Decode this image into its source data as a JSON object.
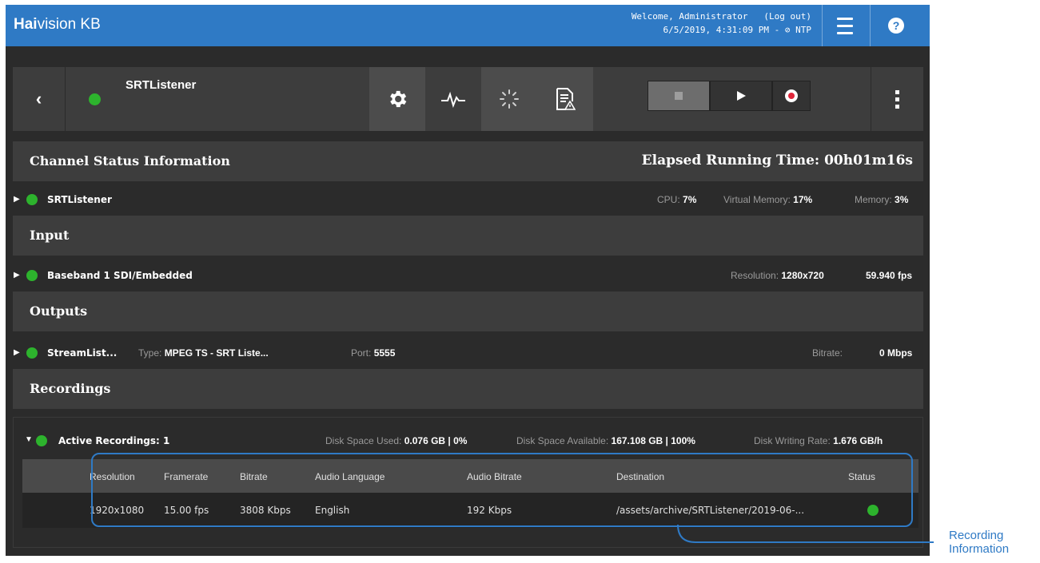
{
  "header": {
    "brand_bold": "Hai",
    "brand_rest": "vision KB",
    "welcome_line": "Welcome, Administrator",
    "logout": "(Log out)",
    "datetime": "6/5/2019, 4:31:09 PM - ",
    "ntp": "⊘ NTP",
    "menu_icon": "hamburger-icon",
    "help_icon": "help-icon",
    "help_glyph": "?"
  },
  "toolbar": {
    "back_glyph": "‹",
    "channel_name": "SRTListener",
    "icons": [
      "gear-icon",
      "signal-icon",
      "loading-icon",
      "report-warning-icon"
    ],
    "transport": [
      "stop",
      "play",
      "record"
    ]
  },
  "status": {
    "title": "Channel Status Information",
    "elapsed": "Elapsed Running Time: 00h01m16s",
    "channel_row": {
      "name": "SRTListener",
      "cpu_label": "CPU: ",
      "cpu_value": "7%",
      "vmem_label": "Virtual Memory: ",
      "vmem_value": "17%",
      "mem_label": "Memory: ",
      "mem_value": "3%"
    }
  },
  "input": {
    "title": "Input",
    "row": {
      "name": "Baseband 1 SDI/Embedded",
      "res_label": "Resolution: ",
      "res_value": "1280x720",
      "fps": "59.940 fps"
    }
  },
  "outputs": {
    "title": "Outputs",
    "row": {
      "name": "StreamList...",
      "type_label": "Type: ",
      "type_value": "MPEG TS - SRT Liste...",
      "port_label": "Port: ",
      "port_value": "5555",
      "bitrate_label": "Bitrate:",
      "bitrate_value": "0 Mbps"
    }
  },
  "recordings": {
    "title": "Recordings",
    "active_label": "Active Recordings: 1",
    "disk_used_label": "Disk Space Used: ",
    "disk_used_value": "0.076 GB | 0%",
    "disk_avail_label": "Disk Space Available: ",
    "disk_avail_value": "167.108 GB | 100%",
    "disk_rate_label": "Disk Writing Rate: ",
    "disk_rate_value": "1.676 GB/h",
    "columns": [
      "Resolution",
      "Framerate",
      "Bitrate",
      "Audio Language",
      "Audio Bitrate",
      "Destination",
      "Status"
    ],
    "rows": [
      {
        "resolution": "1920x1080",
        "framerate": "15.00 fps",
        "bitrate": "3808 Kbps",
        "audio_language": "English",
        "audio_bitrate": "192 Kbps",
        "destination": "/assets/archive/SRTListener/2019-06-...",
        "status_color": "#2db32d"
      }
    ]
  },
  "annotation": {
    "line1": "Recording",
    "line2": "Information"
  },
  "colors": {
    "brand_blue": "#2f7ac5",
    "status_green": "#2db32d",
    "record_red": "#e0263a"
  }
}
